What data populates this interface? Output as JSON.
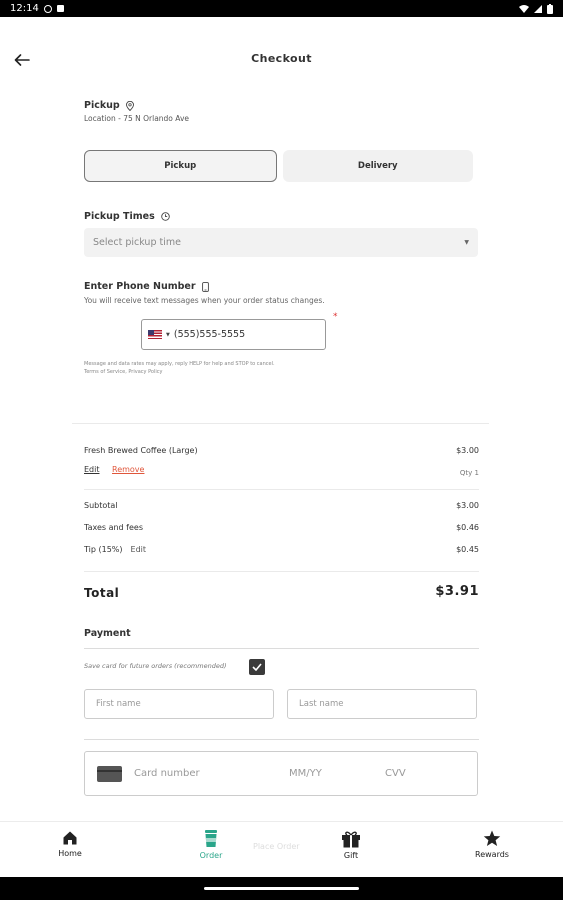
{
  "status_bar": {
    "time": "12:14"
  },
  "header": {
    "title": "Checkout"
  },
  "pickup": {
    "label": "Pickup",
    "location": "Location - 75 N Orlando Ave"
  },
  "order_type": {
    "pickup_label": "Pickup",
    "delivery_label": "Delivery",
    "selected": "Pickup"
  },
  "pickup_times": {
    "label": "Pickup Times",
    "placeholder": "Select pickup time"
  },
  "phone": {
    "label": "Enter Phone Number",
    "subtitle": "You will receive text messages when your order status changes.",
    "value": "(555)555-5555",
    "required_mark": "*"
  },
  "cart": {
    "items": [
      {
        "name": "Fresh Brewed Coffee (Large)",
        "price": "$3.00",
        "qty": "Qty 1",
        "edit_label": "Edit",
        "remove_label": "Remove"
      }
    ],
    "subtotal_label": "Subtotal",
    "subtotal": "$3.00",
    "taxes_label": "Taxes and fees",
    "taxes": "$0.46",
    "tip_label": "Tip (15%)",
    "tip_edit_label": "Edit",
    "tip": "$0.45",
    "total_label": "Total",
    "total": "$3.91"
  },
  "payment": {
    "label": "Payment",
    "save_card_label": "Save card for future orders (recommended)",
    "save_card_checked": true,
    "first_name_placeholder": "First name",
    "last_name_placeholder": "Last name",
    "card_number_placeholder": "Card number",
    "expiry_placeholder": "MM/YY",
    "cvv_placeholder": "CVV"
  },
  "bottom_nav": {
    "items": [
      {
        "label": "Home",
        "icon": "home-icon"
      },
      {
        "label": "Order",
        "icon": "cup-icon"
      },
      {
        "label": "Gift",
        "icon": "gift-icon"
      },
      {
        "label": "Rewards",
        "icon": "star-icon"
      }
    ],
    "active": "Order",
    "hidden_text": "Place Order"
  },
  "colors": {
    "accent": "#2aa58a",
    "remove": "#e0563b",
    "required": "#dd3333"
  }
}
